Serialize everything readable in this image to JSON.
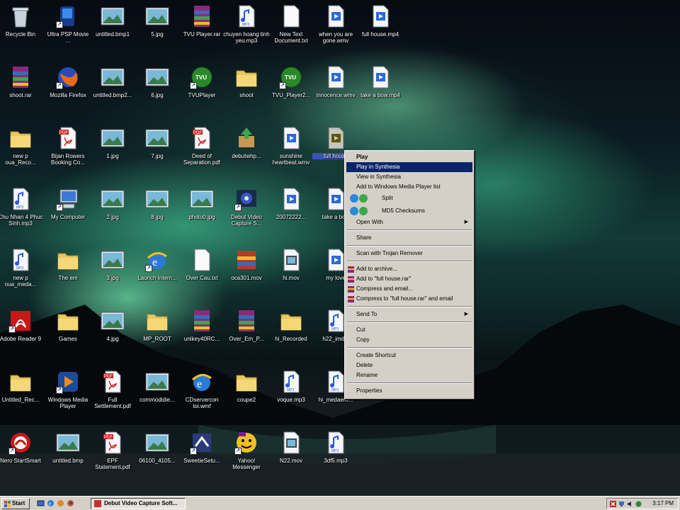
{
  "desktop": {
    "icons": [
      {
        "label": "Recycle Bin",
        "kind": "recycle"
      },
      {
        "label": "Ultra PSP Movie ...",
        "kind": "app-blue"
      },
      {
        "label": "untitled.bmp1",
        "kind": "image"
      },
      {
        "label": "5.jpg",
        "kind": "image"
      },
      {
        "label": "TVU Player.rar",
        "kind": "rar"
      },
      {
        "label": "chuyen hoang tinh yeu.mp3",
        "kind": "mp3"
      },
      {
        "label": "New Text Document.txt",
        "kind": "text"
      },
      {
        "label": "when you are gone.wmv",
        "kind": "wmv"
      },
      {
        "label": "full house.mp4",
        "kind": "wmv"
      },
      {
        "label": "shoot.rar",
        "kind": "rar"
      },
      {
        "label": "Mozilla Firefox",
        "kind": "firefox"
      },
      {
        "label": "untitled.bmp2...",
        "kind": "image"
      },
      {
        "label": "6.jpg",
        "kind": "image"
      },
      {
        "label": "TVUPlayer",
        "kind": "tvu"
      },
      {
        "label": "shoot",
        "kind": "folder"
      },
      {
        "label": "TVU_Player2...",
        "kind": "tvu"
      },
      {
        "label": "innocence.wmv",
        "kind": "wmv"
      },
      {
        "label": "take a bow.mp4",
        "kind": "wmv"
      },
      {
        "label": "new p oua_Reco...",
        "kind": "folder"
      },
      {
        "label": "Bijan Rowers Booking Co...",
        "kind": "pdf"
      },
      {
        "label": "1.jpg",
        "kind": "image"
      },
      {
        "label": "7.jpg",
        "kind": "image"
      },
      {
        "label": "Deed of Separation.pdf",
        "kind": "pdf"
      },
      {
        "label": "debutwhp...",
        "kind": "installer"
      },
      {
        "label": "sunshine heartbeat.wmv",
        "kind": "wmv"
      },
      {
        "label": "full house",
        "kind": "wmv-selected"
      },
      {
        "label": "Chu Nhan 4 Phuc Sinh.mp3",
        "kind": "mp3"
      },
      {
        "label": "My Computer",
        "kind": "computer"
      },
      {
        "label": "2.jpg",
        "kind": "image"
      },
      {
        "label": "8.jpg",
        "kind": "image"
      },
      {
        "label": "photo0.jpg",
        "kind": "image"
      },
      {
        "label": "Debut Video Capture S...",
        "kind": "debut"
      },
      {
        "label": "20072222...",
        "kind": "wmv"
      },
      {
        "label": "take a bow",
        "kind": "wmv"
      },
      {
        "label": "new p oua_meda...",
        "kind": "mp3"
      },
      {
        "label": "The em",
        "kind": "folder"
      },
      {
        "label": "3.jpg",
        "kind": "image"
      },
      {
        "label": "Launch Intern...",
        "kind": "ie"
      },
      {
        "label": "Over Cau.txt",
        "kind": "text"
      },
      {
        "label": "oca301.mov",
        "kind": "winrar"
      },
      {
        "label": "hi.mov",
        "kind": "movie"
      },
      {
        "label": "my love",
        "kind": "wmv"
      },
      {
        "label": "Adobe Reader 9",
        "kind": "adobe"
      },
      {
        "label": "Games",
        "kind": "folder"
      },
      {
        "label": "4.jpg",
        "kind": "image"
      },
      {
        "label": "MP_ROOT",
        "kind": "folder"
      },
      {
        "label": "unikey40RC...",
        "kind": "rar"
      },
      {
        "label": "Over_Em_P...",
        "kind": "rar"
      },
      {
        "label": "hi_Recorded",
        "kind": "folder"
      },
      {
        "label": "h22_imd...",
        "kind": "mp3"
      },
      {
        "label": "Untitled_Rec...",
        "kind": "folder"
      },
      {
        "label": "Windows Media Player",
        "kind": "wmp"
      },
      {
        "label": "Full Settlement.pdf",
        "kind": "pdf"
      },
      {
        "label": "commodidie...",
        "kind": "image"
      },
      {
        "label": "CDservercon toi.wmf",
        "kind": "ie-doc"
      },
      {
        "label": "coupe2",
        "kind": "folder"
      },
      {
        "label": "voque.mp3",
        "kind": "mp3"
      },
      {
        "label": "hi_medaem...",
        "kind": "mp3"
      },
      {
        "label": "Nero StartSmart",
        "kind": "nero"
      },
      {
        "label": "untitled.bmp",
        "kind": "image"
      },
      {
        "label": "EPF Statement.pdf",
        "kind": "pdf"
      },
      {
        "label": "06100_4105...",
        "kind": "image"
      },
      {
        "label": "SweetieSetu...",
        "kind": "setup"
      },
      {
        "label": "Yahoo! Messenger",
        "kind": "yahoo"
      },
      {
        "label": "N22.mov",
        "kind": "movie"
      },
      {
        "label": "3df5.mp3",
        "kind": "mp3"
      }
    ]
  },
  "context_menu": {
    "items": [
      {
        "label": "Play",
        "bold": true
      },
      {
        "label": "Play in Synthesia",
        "highlighted": true
      },
      {
        "label": "View in Synthesia"
      },
      {
        "label": "Add to Windows Media Player list"
      },
      {
        "label": "Split",
        "tall": true
      },
      {
        "label": "MD5 Checksums",
        "tall": true
      },
      {
        "label": "Open With",
        "submenu": true
      },
      {
        "separator": true
      },
      {
        "label": "Share"
      },
      {
        "separator": true
      },
      {
        "label": "Scan with Trojan Remover"
      },
      {
        "separator": true
      },
      {
        "label": "Add to archive...",
        "icon": "winrar"
      },
      {
        "label": "Add to \"full house.rar\"",
        "icon": "winrar"
      },
      {
        "label": "Compress and email...",
        "icon": "winrar"
      },
      {
        "label": "Compress to \"full house.rar\" and email",
        "icon": "winrar"
      },
      {
        "separator": true
      },
      {
        "label": "Send To",
        "submenu": true
      },
      {
        "separator": true
      },
      {
        "label": "Cut"
      },
      {
        "label": "Copy"
      },
      {
        "separator": true
      },
      {
        "label": "Create Shortcut"
      },
      {
        "label": "Delete"
      },
      {
        "label": "Rename"
      },
      {
        "separator": true
      },
      {
        "label": "Properties"
      }
    ]
  },
  "taskbar": {
    "start_label": "Start",
    "tasks": [
      {
        "label": "Debut Video Capture Soft..."
      }
    ],
    "clock": "3:17 PM"
  }
}
